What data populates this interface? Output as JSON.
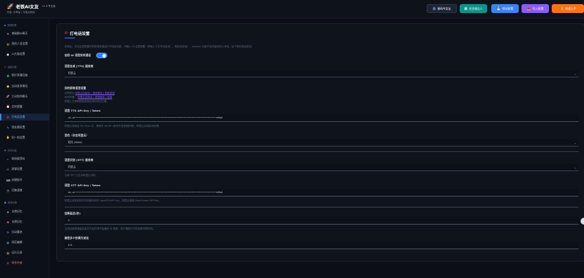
{
  "header": {
    "app_title": "老铁AI女友",
    "version": "v1.6 专业版",
    "subtitle": "作者: 分享者 | 专属定制版",
    "buttons": [
      {
        "label": "接码AI女友",
        "icon": "grid-icon",
        "color": "#1e2434"
      },
      {
        "label": "关注喵达人",
        "icon": "grid-icon",
        "color": "#0d9488"
      },
      {
        "label": "保存配置",
        "icon": "save-icon",
        "color": "#3b82f6"
      },
      {
        "label": "导入配置",
        "icon": "import-icon",
        "color": "#8b5cf6"
      },
      {
        "label": "快速上手",
        "icon": "book-icon",
        "color": "#f97316"
      }
    ]
  },
  "sidebar": {
    "sections": [
      {
        "title": "基础配置",
        "icon": "diamond-icon",
        "items": [
          {
            "label": "基础聊AI聊天",
            "icon": "chat-icon"
          },
          {
            "label": "角色人设设置",
            "icon": "doc-icon"
          },
          {
            "label": "AI大脑设置",
            "icon": "bubble-icon"
          }
        ]
      },
      {
        "title": "高级功能",
        "icon": "check-icon",
        "items": [
          {
            "label": "图片表情回复",
            "icon": "image-icon"
          },
          {
            "label": "自动发表情包",
            "icon": "smile-icon"
          },
          {
            "label": "主动找你聊天",
            "icon": "rocket-icon"
          },
          {
            "label": "定时提醒",
            "icon": "alarm-icon"
          },
          {
            "label": "打电话设置",
            "icon": "phone-icon",
            "active": true
          },
          {
            "label": "朋友圈设置",
            "icon": "pencil-icon"
          },
          {
            "label": "拍一拍设置",
            "icon": "hand-icon"
          }
        ]
      },
      {
        "title": "系统功能",
        "icon": "gear-icon",
        "items": [
          {
            "label": "联网搜资料",
            "icon": "search-icon"
          },
          {
            "label": "群聊设置",
            "icon": "group-icon"
          },
          {
            "label": "快捷指令",
            "icon": "keyboard-icon"
          },
          {
            "label": "回复速度",
            "icon": "clock-icon"
          }
        ]
      },
      {
        "title": "其他设置",
        "icon": "grid-icon",
        "items": [
          {
            "label": "长期记忆",
            "icon": "disk-icon"
          },
          {
            "label": "长期记忆",
            "icon": "brain-icon"
          },
          {
            "label": "自动重启",
            "icon": "refresh-icon"
          },
          {
            "label": "网页编辑",
            "icon": "globe-icon"
          },
          {
            "label": "运行记录",
            "icon": "log-icon"
          },
          {
            "label": "联系作者",
            "icon": "phone-icon",
            "danger": true
          }
        ]
      }
    ]
  },
  "panel": {
    "title": "打电话设置",
    "description": "说明此，在这这里配置可获得语音通话打开电话功能，可输入 AI 这里配置（你输入了文字后发送），和系统说话），session 功能不支持接收他人来电，给下载切电话发送。",
    "toggle_label": "启用 AI 语音实时通话",
    "toggle_on": true,
    "tts_label": "语音合成 (TTS) 服务商",
    "tts_value": "阿里云",
    "guide_title": "如何获取语音设置",
    "guide_line1_prefix": "在阿里云",
    "guide_line1_link": "阿里云控制台 | 语音服务 | 获取密钥",
    "guide_line2_prefix": "填写阿里：",
    "guide_line2_link": "阿里云控制台 | 语音服务 | 密钥",
    "guide_line3": "根据上方说明获取密钥后填到对应位置。",
    "tts_key_label": "语音 TTS API Key / Token",
    "tts_key_value": "sk-a••••••••••••••••••••••••••••••••••••••••••••••••••••••••••••••••••••••••••••••••••••••••••••••••nMaV",
    "tts_key_hint": "阿里云控制台 My Keys 中，请填写 AK/SK (用来开发音频处理)，阿里云后端自动处理。",
    "voice_label": "音色（仅在阿里云）",
    "voice_value": "阳光 (Male)",
    "stt_label": "语音识别 (STT) 服务商",
    "stt_value": "阿里云",
    "stt_hint": "当前 STT 已支持阿里云识别。",
    "stt_key_label": "语音 STT API Key / Token",
    "stt_key_value": "sk-a••••••••••••••••••••••••••••••••••••••••••••••••••••••••••••••••••••••••••••••••••••••••••••••••nMaV",
    "stt_key_hint": "阿里云或其他实时识别服务填写 AppKEY/API Key，阿里云使用 DashScope API Key。",
    "timeout_label": "挂断延迟(秒)",
    "timeout_value": "3",
    "timeout_hint": "当说话者等通话结束并开启时间开始播放 AI 语音，用于缓和打开的挂断切断时间。",
    "speed_label": "静音多少秒算为说话",
    "speed_value": "0.8"
  }
}
